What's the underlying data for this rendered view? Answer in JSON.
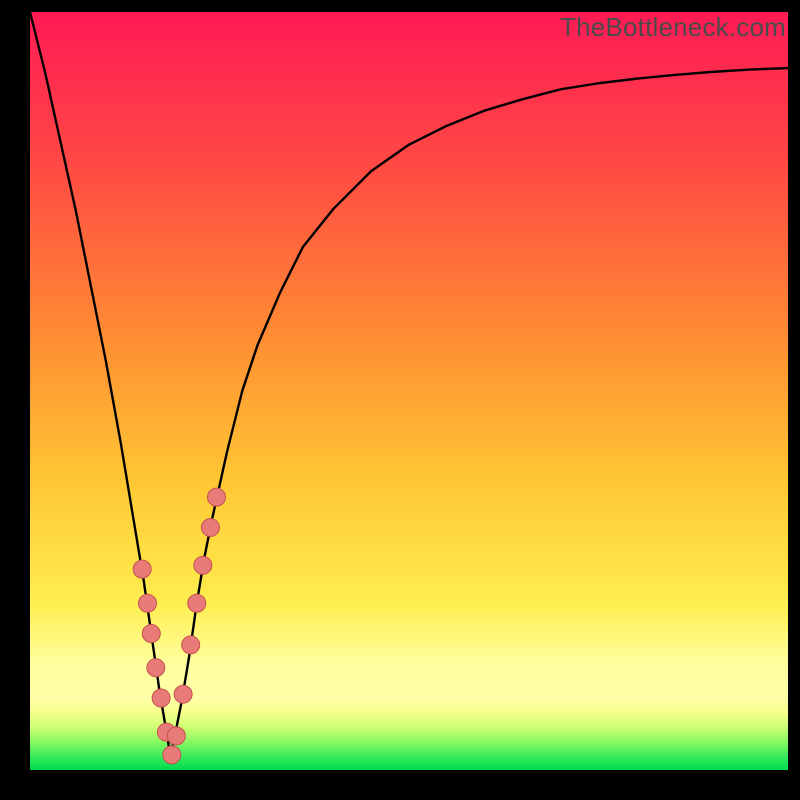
{
  "watermark": "TheBottleneck.com",
  "colors": {
    "grad_top": "#ff1a55",
    "grad_mid1": "#ff5a3a",
    "grad_mid2": "#ffae2e",
    "grad_mid3": "#ffe94a",
    "grad_band": "#ffff9a",
    "grad_bottom": "#00e05a",
    "curve": "#000000",
    "marker_fill": "#e87a78",
    "marker_stroke": "#c45250"
  },
  "chart_data": {
    "type": "line",
    "title": "",
    "xlabel": "",
    "ylabel": "",
    "x_range": [
      0,
      100
    ],
    "y_range": [
      0,
      100
    ],
    "series": [
      {
        "name": "bottleneck-curve",
        "x": [
          0,
          2,
          4,
          6,
          8,
          10,
          12,
          14,
          15,
          16,
          17,
          18,
          18.5,
          19,
          20,
          21,
          22,
          23,
          24,
          26,
          28,
          30,
          33,
          36,
          40,
          45,
          50,
          55,
          60,
          65,
          70,
          75,
          80,
          85,
          90,
          95,
          100
        ],
        "y": [
          100,
          92,
          83,
          74,
          64,
          54,
          43,
          31,
          25,
          18,
          11,
          5,
          2,
          4,
          9,
          15,
          22,
          28,
          33,
          42,
          50,
          56,
          63,
          69,
          74,
          79,
          82.5,
          85,
          87,
          88.5,
          89.8,
          90.6,
          91.2,
          91.7,
          92.1,
          92.4,
          92.6
        ]
      }
    ],
    "markers": {
      "name": "highlight-points",
      "x": [
        14.8,
        15.5,
        16.0,
        16.6,
        17.3,
        18.0,
        18.7,
        19.3,
        20.2,
        21.2,
        22.0,
        22.8,
        23.8,
        24.6
      ],
      "y": [
        26.5,
        22.0,
        18.0,
        13.5,
        9.5,
        5.0,
        2.0,
        4.5,
        10.0,
        16.5,
        22.0,
        27.0,
        32.0,
        36.0
      ]
    }
  }
}
